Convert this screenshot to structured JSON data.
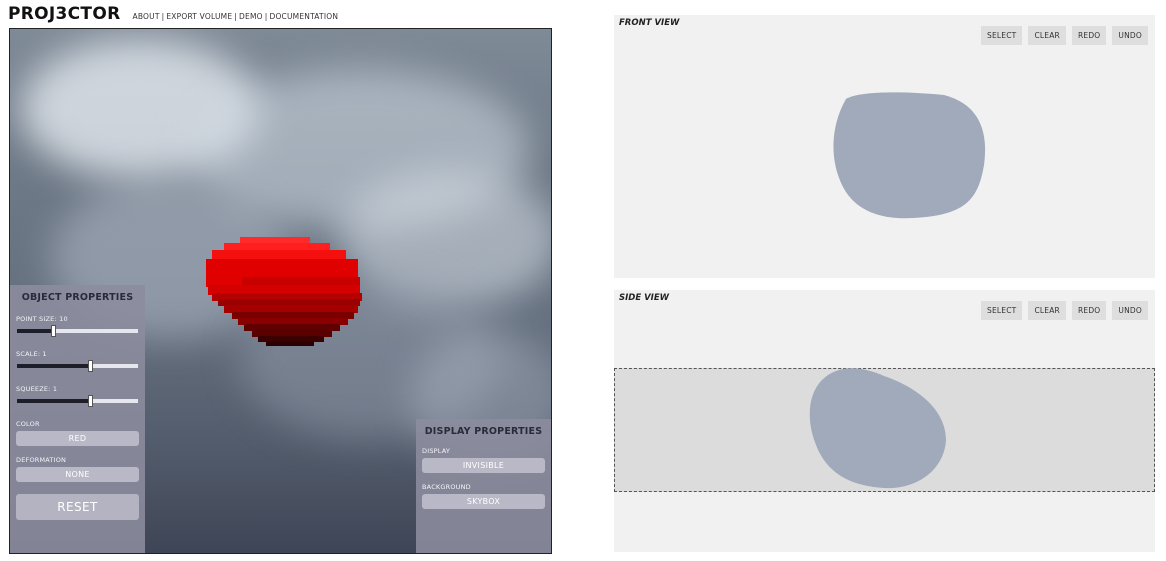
{
  "app": {
    "logo": "PROJ3CTOR",
    "nav": [
      "ABOUT",
      "EXPORT VOLUME",
      "DEMO",
      "DOCUMENTATION"
    ],
    "nav_separator": "|"
  },
  "viewport": {
    "object_color": "#e60000",
    "object_properties": {
      "title": "OBJECT PROPERTIES",
      "point_size": {
        "label": "POINT SIZE: 10",
        "value": 0.3
      },
      "scale": {
        "label": "SCALE: 1",
        "value": 0.6
      },
      "squeeze": {
        "label": "SQUEEZE: 1",
        "value": 0.6
      },
      "color_label": "COLOR",
      "color_value": "RED",
      "deformation_label": "DEFORMATION",
      "deformation_value": "NONE",
      "reset_label": "RESET"
    },
    "display_properties": {
      "title": "DISPLAY PROPERTIES",
      "display_label": "DISPLAY",
      "display_value": "INVISIBLE",
      "background_label": "BACKGROUND",
      "background_value": "SKYBOX"
    }
  },
  "front_view": {
    "title": "FRONT VIEW",
    "buttons": [
      "SELECT",
      "CLEAR",
      "REDO",
      "UNDO"
    ],
    "shape_color": "#a0aabb"
  },
  "side_view": {
    "title": "SIDE VIEW",
    "buttons": [
      "SELECT",
      "CLEAR",
      "REDO",
      "UNDO"
    ],
    "shape_color": "#a0aabb"
  }
}
